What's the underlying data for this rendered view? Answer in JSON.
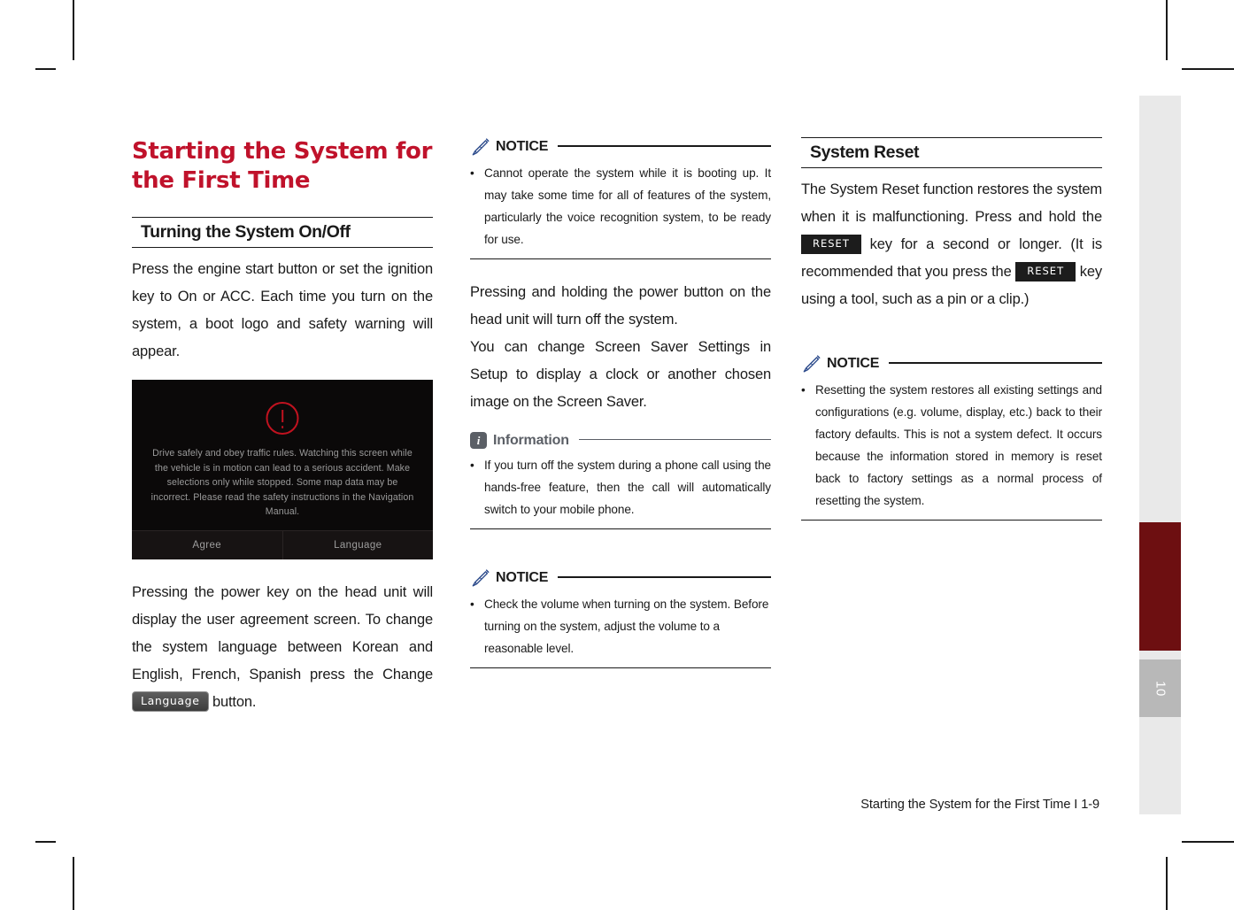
{
  "page": {
    "footer": "Starting the System for the First Time I 1-9",
    "edge_tab_number": "10"
  },
  "left_column": {
    "main_heading": "Starting the System for the First Time",
    "section_heading": "Turning the System On/Off",
    "paragraph_1": "Press the engine start button or set the ignition key to On or ACC. Each time you turn on the system, a boot logo and safety warning will appear.",
    "figure": {
      "warning_text": "Drive safely and obey traffic rules. Watching this screen while the vehicle is in motion can lead to a serious accident. Make selections only while stopped. Some map data may be incorrect. Please read the safety instructions in the Navigation Manual.",
      "button_agree": "Agree",
      "button_language": "Language"
    },
    "paragraph_2_part1": "Pressing the power key on the head unit will display the user agreement screen. To change the system language between Korean and English, French, Spanish press the Change",
    "paragraph_2_badge": "Language",
    "paragraph_2_part2": "button."
  },
  "middle_column": {
    "notice_1": {
      "title": "NOTICE",
      "bullet": "Cannot operate the system while it is booting up. It may take some time for all of features of the system, particularly the voice recognition system, to be ready for use."
    },
    "paragraph_1": "Pressing and holding the power button on the head unit will turn off the system.",
    "paragraph_2": "You can change Screen Saver Settings in Setup to display a clock or another chosen image on the Screen Saver.",
    "information": {
      "title": "Information",
      "bullet": "If you turn off the system during a phone call using the hands-free feature, then the call will automatically switch to your mobile phone."
    },
    "notice_2": {
      "title": "NOTICE",
      "bullet": "Check the volume when turning on the system. Before turning on the system, adjust the volume to a reasonable level."
    }
  },
  "right_column": {
    "section_heading": "System Reset",
    "paragraph_part1": "The System Reset function restores the system when it is malfunctioning. Press and hold the",
    "badge_reset_1": "RESET",
    "paragraph_part2": "key for a second or longer. (It is recommended that you press the",
    "badge_reset_2": "RESET",
    "paragraph_part3": "key using a tool, such as a pin or a clip.)",
    "notice": {
      "title": "NOTICE",
      "bullet": "Resetting the system restores all existing settings and configurations (e.g. volume, display, etc.) back to their factory defaults. This is not a system defect. It occurs because the information stored in memory is reset back to factory settings as a normal process of resetting the system."
    }
  },
  "icons": {
    "pencil": "pencil-icon",
    "info": "info-icon",
    "warning": "warning-icon"
  },
  "colors": {
    "heading_red": "#c0122b",
    "tab_red": "#6d0f11",
    "tab_gray": "#b8b8b8",
    "edge_strip": "#e9e9e9"
  }
}
